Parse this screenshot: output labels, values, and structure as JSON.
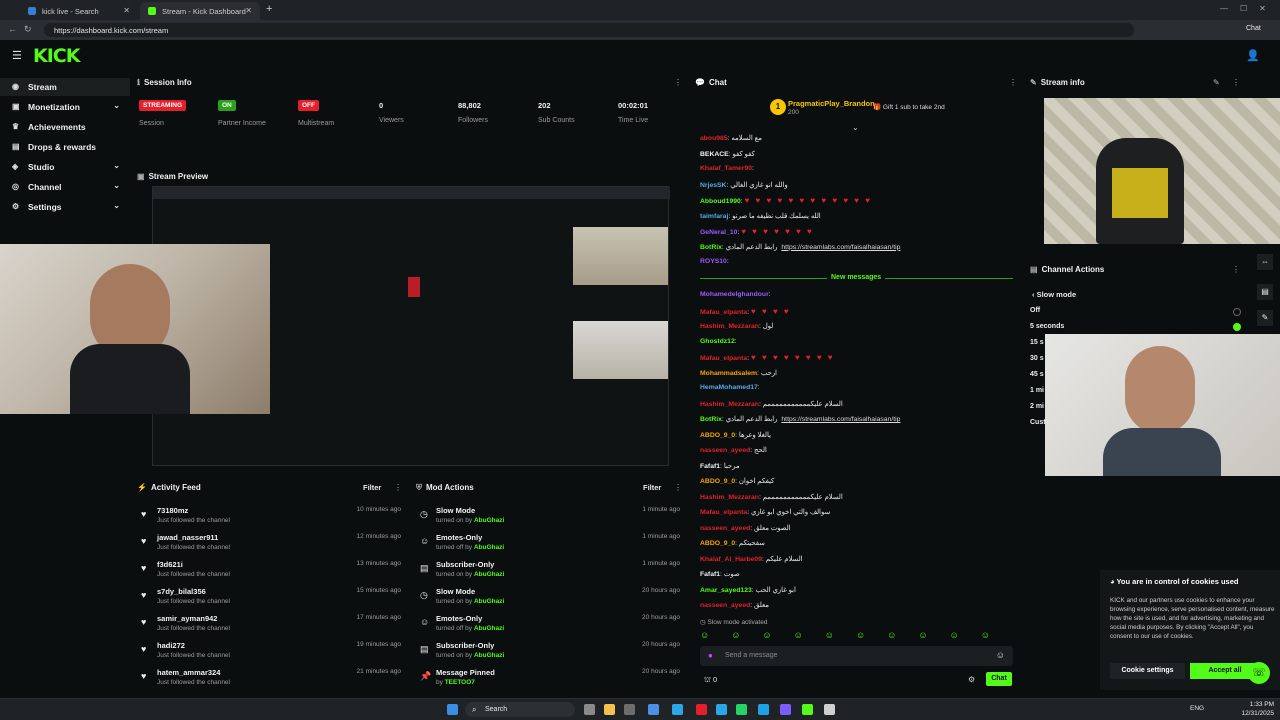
{
  "browser": {
    "tabs": [
      {
        "title": "kick live - Search"
      },
      {
        "title": "Stream - Kick Dashboard"
      }
    ],
    "url": "https://dashboard.kick.com/stream",
    "chat_button": "Chat"
  },
  "brand": {
    "logo": "KICK",
    "accent": "#53fc18"
  },
  "sidebar": {
    "items": [
      {
        "label": "Stream",
        "icon": "stream-icon"
      },
      {
        "label": "Monetization",
        "icon": "money-icon"
      },
      {
        "label": "Achievements",
        "icon": "trophy-icon"
      },
      {
        "label": "Drops & rewards",
        "icon": "gift-icon"
      },
      {
        "label": "Studio",
        "icon": "studio-icon"
      },
      {
        "label": "Channel",
        "icon": "channel-icon"
      },
      {
        "label": "Settings",
        "icon": "gear-icon"
      }
    ]
  },
  "session_info": {
    "title": "Session Info",
    "stats": [
      {
        "value": "STREAMING",
        "label": "Session",
        "kind": "badge-red"
      },
      {
        "value": "ON",
        "label": "Partner Income",
        "kind": "badge-green"
      },
      {
        "value": "OFF",
        "label": "Multistream",
        "kind": "badge-red"
      },
      {
        "value": "0",
        "label": "Viewers",
        "kind": "text"
      },
      {
        "value": "88,802",
        "label": "Followers",
        "kind": "text"
      },
      {
        "value": "202",
        "label": "Sub Counts",
        "kind": "text"
      },
      {
        "value": "00:02:01",
        "label": "Time Live",
        "kind": "text"
      }
    ]
  },
  "stream_preview": {
    "title": "Stream Preview"
  },
  "activity_feed": {
    "title": "Activity Feed",
    "filter": "Filter",
    "items": [
      {
        "name": "73180mz",
        "action": "Just followed the channel",
        "time": "10 minutes ago"
      },
      {
        "name": "jawad_nasser911",
        "action": "Just followed the channel",
        "time": "12 minutes ago"
      },
      {
        "name": "f3d621i",
        "action": "Just followed the channel",
        "time": "13 minutes ago"
      },
      {
        "name": "s7dy_bilal356",
        "action": "Just followed the channel",
        "time": "15 minutes ago"
      },
      {
        "name": "samir_ayman942",
        "action": "Just followed the channel",
        "time": "17 minutes ago"
      },
      {
        "name": "hadi272",
        "action": "Just followed the channel",
        "time": "19 minutes ago"
      },
      {
        "name": "hatem_ammar324",
        "action": "Just followed the channel",
        "time": "21 minutes ago"
      }
    ]
  },
  "mod_actions": {
    "title": "Mod Actions",
    "filter": "Filter",
    "items": [
      {
        "name": "Slow Mode",
        "action": "turned on by",
        "by": "AbuGhazi",
        "time": "1 minute ago"
      },
      {
        "name": "Emotes-Only",
        "action": "turned off by",
        "by": "AbuGhazi",
        "time": "1 minute ago"
      },
      {
        "name": "Subscriber-Only",
        "action": "turned on by",
        "by": "AbuGhazi",
        "time": "1 minute ago"
      },
      {
        "name": "Slow Mode",
        "action": "turned on by",
        "by": "AbuGhazi",
        "time": "20 hours ago"
      },
      {
        "name": "Emotes-Only",
        "action": "turned off by",
        "by": "AbuGhazi",
        "time": "20 hours ago"
      },
      {
        "name": "Subscriber-Only",
        "action": "turned on by",
        "by": "AbuGhazi",
        "time": "20 hours ago"
      },
      {
        "name": "Message Pinned",
        "action": "by",
        "by": "TEETOO7",
        "time": "20 hours ago"
      }
    ]
  },
  "chat": {
    "title": "Chat",
    "pinned_user": "PragmaticPlay_Brandon",
    "pinned_count": "200",
    "pinned_gift": "Gift 1 sub to take 2nd",
    "new_messages": "New messages",
    "lines": [
      {
        "user": "abou985",
        "text": "مع السلامه",
        "color": "#e3202b"
      },
      {
        "user": "BEKACE",
        "text": "كفو كفو",
        "color": "#f2f2f2"
      },
      {
        "user": "Khalaf_Tamer90",
        "text": "",
        "color": "#e3202b"
      },
      {
        "user": "NrjesSK",
        "text": "والله انو غازي الغالي",
        "color": "#5aa9e6"
      },
      {
        "user": "Abboud1990",
        "text": "♥ ♥ ♥ ♥ ♥ ♥ ♥ ♥ ♥ ♥ ♥ ♥",
        "color": "#53fc18"
      },
      {
        "user": "taimfaraj",
        "text": "الله يسلمك قلب نظيفه ما صرتو",
        "color": "#5aa9e6"
      },
      {
        "user": "GeNeral_10",
        "text": "♥ ♥ ♥ ♥ ♥ ♥ ♥",
        "color": "#9b59ff"
      },
      {
        "user": "BotRix",
        "text": "رابط الدعم المادي",
        "link": "https://streamlabs.com/faisalhaiasan/tip",
        "color": "#53fc18"
      },
      {
        "user": "ROYS10",
        "text": "",
        "color": "#9b59ff"
      }
    ],
    "new_lines": [
      {
        "user": "Mohamedelghandour",
        "text": "",
        "color": "#9b59ff"
      },
      {
        "user": "Mafau_elpanta",
        "text": "♥ ♥ ♥ ♥",
        "color": "#e3202b"
      },
      {
        "user": "Hashim_Mezzaran",
        "text": "لول",
        "color": "#e3202b"
      },
      {
        "user": "Ghostdz12",
        "text": "",
        "color": "#53fc18"
      },
      {
        "user": "Mafau_elpanta",
        "text": "♥ ♥ ♥ ♥ ♥ ♥ ♥ ♥",
        "color": "#e3202b"
      },
      {
        "user": "Mohammadsalem",
        "text": "ارحب",
        "color": "#f7a400"
      },
      {
        "user": "HemaMohamed17",
        "text": "",
        "color": "#5aa9e6"
      },
      {
        "user": "Hashim_Mezzaran",
        "text": "السلام عليكمممممممممممم",
        "color": "#e3202b"
      },
      {
        "user": "BotRix",
        "text": "رابط الدعم المادي",
        "link": "https://streamlabs.com/faisalhaiasan/tip",
        "color": "#53fc18"
      },
      {
        "user": "ABDO_9_0",
        "text": "يالغلا وعرها",
        "color": "#f7a400"
      },
      {
        "user": "nasseen_ayeed",
        "text": "الحج",
        "color": "#e3202b"
      },
      {
        "user": "Fafaf1",
        "text": "مرحبا",
        "color": "#f2f2f2"
      },
      {
        "user": "ABDO_9_0",
        "text": "كيفكم اخوان",
        "color": "#f7a400"
      },
      {
        "user": "Hashim_Mezzaran",
        "text": "السلام عليكمممممممممممم",
        "color": "#e3202b"
      },
      {
        "user": "Mafau_elpanta",
        "text": "سوالف والتي اخوي ابو غازي",
        "color": "#e3202b"
      },
      {
        "user": "nasseen_ayeed",
        "text": "الصوت معلق",
        "color": "#e3202b"
      },
      {
        "user": "ABDO_9_0",
        "text": "سفحيتكم",
        "color": "#f7a400"
      },
      {
        "user": "Khalaf_Al_Harbe09",
        "text": "السلام عليكم",
        "color": "#e3202b"
      },
      {
        "user": "Fafaf1",
        "text": "صوت",
        "color": "#f2f2f2"
      },
      {
        "user": "Amar_sayed123",
        "text": "ابو غازي الحب",
        "color": "#53fc18"
      },
      {
        "user": "nasseen_ayeed",
        "text": "معلق",
        "color": "#e3202b"
      }
    ],
    "slow_mode_note": "Slow mode activated",
    "input_placeholder": "Send a message",
    "viewer_count": "0",
    "send_button": "Chat"
  },
  "stream_info": {
    "title": "Stream info"
  },
  "channel_actions": {
    "title": "Channel Actions",
    "slow_mode": "Slow mode",
    "options": [
      "Off",
      "5 seconds",
      "15 s",
      "30 s",
      "45 s",
      "1 mi",
      "2 mi",
      "Cust"
    ]
  },
  "cookies": {
    "title": "You are in control of cookies used",
    "body": "KICK and our partners use cookies to enhance your browsing experience, serve personalised content, measure how the site is used, and for advertising, marketing and social media purposes. By clicking \"Accept All\", you consent to our use of cookies.",
    "settings_button": "Cookie settings",
    "accept_button": "Accept all"
  },
  "taskbar": {
    "search": "Search",
    "lang": "ENG",
    "time": "1:33 PM",
    "date": "12/31/2025"
  }
}
